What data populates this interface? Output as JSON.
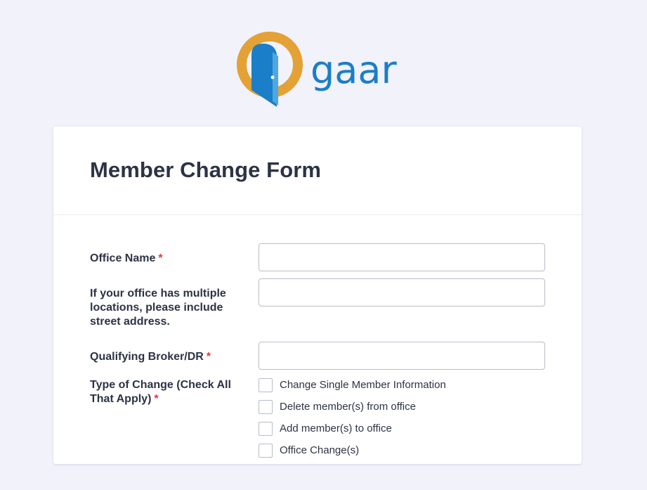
{
  "logo": {
    "text": "gaar",
    "colors": {
      "ring": "#e3a136",
      "door": "#1a7ec8",
      "text": "#1a7ec8"
    }
  },
  "form": {
    "title": "Member Change Form",
    "fields": [
      {
        "label": "Office Name",
        "required": "*",
        "value": ""
      },
      {
        "label": "If your office has multiple locations, please include street address.",
        "value": ""
      },
      {
        "label": "Qualifying Broker/DR",
        "required": "*",
        "value": ""
      }
    ],
    "change_type": {
      "label": "Type of Change (Check All That Apply)",
      "required": "*",
      "options": [
        "Change Single Member Information",
        "Delete member(s) from office",
        "Add member(s) to office",
        "Office Change(s)"
      ]
    }
  }
}
